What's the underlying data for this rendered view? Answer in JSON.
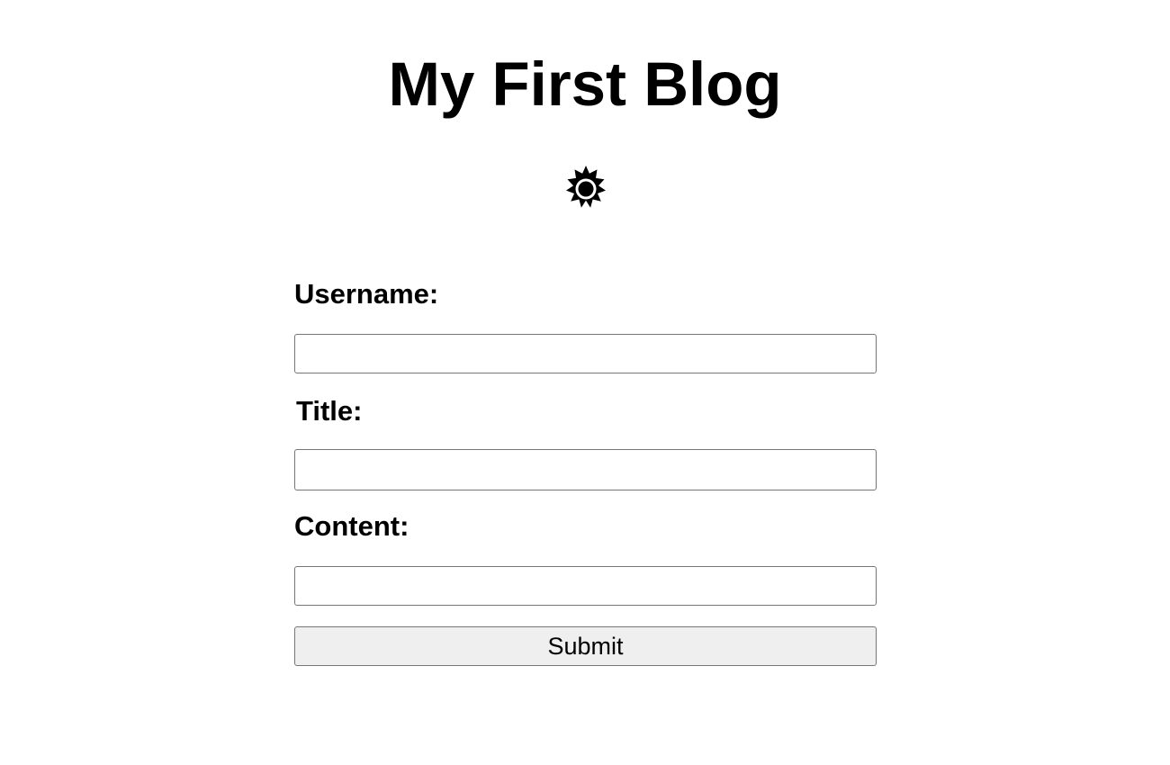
{
  "page": {
    "title": "My First Blog"
  },
  "theme_toggle": {
    "icon": "sun-icon"
  },
  "form": {
    "username_label": "Username:",
    "username_value": "",
    "title_label": "Title:",
    "title_value": "",
    "content_label": "Content:",
    "content_value": "",
    "submit_label": "Submit"
  },
  "colors": {
    "background": "#ffffff",
    "text": "#000000",
    "input_border": "#767676",
    "button_background": "#efefef"
  }
}
